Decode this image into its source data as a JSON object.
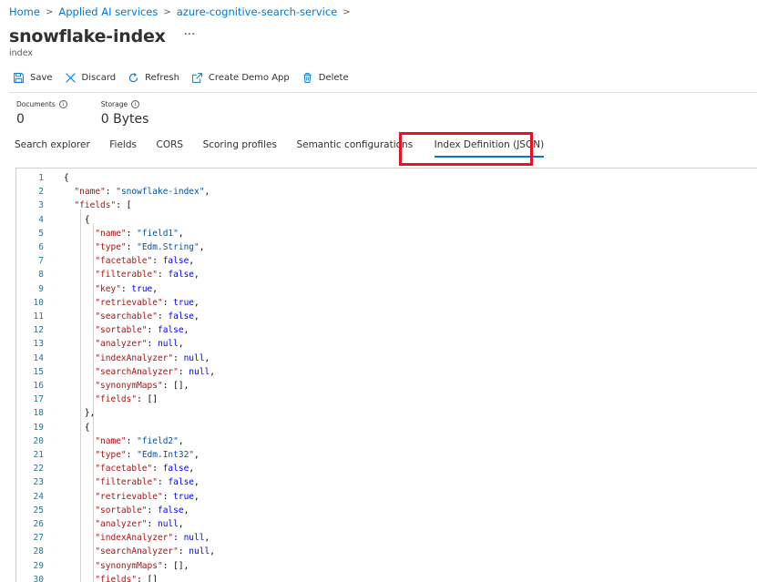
{
  "breadcrumb": {
    "items": [
      "Home",
      "Applied AI services",
      "azure-cognitive-search-service"
    ],
    "separator": ">"
  },
  "page": {
    "title": "snowflake-index",
    "more": "···",
    "subtitle": "index"
  },
  "toolbar": {
    "save": "Save",
    "discard": "Discard",
    "refresh": "Refresh",
    "create_demo_app": "Create Demo App",
    "delete": "Delete"
  },
  "stats": {
    "documents_label": "Documents",
    "documents_value": "0",
    "storage_label": "Storage",
    "storage_value": "0 Bytes"
  },
  "tabs": [
    "Search explorer",
    "Fields",
    "CORS",
    "Scoring profiles",
    "Semantic configurations",
    "Index Definition (JSON)"
  ],
  "active_tab": "Index Definition (JSON)",
  "colors": {
    "accent": "#0078d4",
    "highlight": "#e81123",
    "json_key": "#a31515",
    "json_string": "#0451a5",
    "json_keyword": "#0000ff",
    "line_number": "#237893"
  },
  "editor": {
    "lines": [
      [
        {
          "t": "p",
          "v": "{"
        }
      ],
      [
        {
          "t": "p",
          "v": "  "
        },
        {
          "t": "k",
          "v": "\"name\""
        },
        {
          "t": "p",
          "v": ": "
        },
        {
          "t": "s",
          "v": "\"snowflake-index\""
        },
        {
          "t": "p",
          "v": ","
        }
      ],
      [
        {
          "t": "p",
          "v": "  "
        },
        {
          "t": "k",
          "v": "\"fields\""
        },
        {
          "t": "p",
          "v": ": ["
        }
      ],
      [
        {
          "t": "p",
          "v": "    {"
        }
      ],
      [
        {
          "t": "p",
          "v": "      "
        },
        {
          "t": "k",
          "v": "\"name\""
        },
        {
          "t": "p",
          "v": ": "
        },
        {
          "t": "s",
          "v": "\"field1\""
        },
        {
          "t": "p",
          "v": ","
        }
      ],
      [
        {
          "t": "p",
          "v": "      "
        },
        {
          "t": "k",
          "v": "\"type\""
        },
        {
          "t": "p",
          "v": ": "
        },
        {
          "t": "s",
          "v": "\"Edm.String\""
        },
        {
          "t": "p",
          "v": ","
        }
      ],
      [
        {
          "t": "p",
          "v": "      "
        },
        {
          "t": "k",
          "v": "\"facetable\""
        },
        {
          "t": "p",
          "v": ": "
        },
        {
          "t": "w",
          "v": "false"
        },
        {
          "t": "p",
          "v": ","
        }
      ],
      [
        {
          "t": "p",
          "v": "      "
        },
        {
          "t": "k",
          "v": "\"filterable\""
        },
        {
          "t": "p",
          "v": ": "
        },
        {
          "t": "w",
          "v": "false"
        },
        {
          "t": "p",
          "v": ","
        }
      ],
      [
        {
          "t": "p",
          "v": "      "
        },
        {
          "t": "k",
          "v": "\"key\""
        },
        {
          "t": "p",
          "v": ": "
        },
        {
          "t": "w",
          "v": "true"
        },
        {
          "t": "p",
          "v": ","
        }
      ],
      [
        {
          "t": "p",
          "v": "      "
        },
        {
          "t": "k",
          "v": "\"retrievable\""
        },
        {
          "t": "p",
          "v": ": "
        },
        {
          "t": "w",
          "v": "true"
        },
        {
          "t": "p",
          "v": ","
        }
      ],
      [
        {
          "t": "p",
          "v": "      "
        },
        {
          "t": "k",
          "v": "\"searchable\""
        },
        {
          "t": "p",
          "v": ": "
        },
        {
          "t": "w",
          "v": "false"
        },
        {
          "t": "p",
          "v": ","
        }
      ],
      [
        {
          "t": "p",
          "v": "      "
        },
        {
          "t": "k",
          "v": "\"sortable\""
        },
        {
          "t": "p",
          "v": ": "
        },
        {
          "t": "w",
          "v": "false"
        },
        {
          "t": "p",
          "v": ","
        }
      ],
      [
        {
          "t": "p",
          "v": "      "
        },
        {
          "t": "k",
          "v": "\"analyzer\""
        },
        {
          "t": "p",
          "v": ": "
        },
        {
          "t": "w",
          "v": "null"
        },
        {
          "t": "p",
          "v": ","
        }
      ],
      [
        {
          "t": "p",
          "v": "      "
        },
        {
          "t": "k",
          "v": "\"indexAnalyzer\""
        },
        {
          "t": "p",
          "v": ": "
        },
        {
          "t": "w",
          "v": "null"
        },
        {
          "t": "p",
          "v": ","
        }
      ],
      [
        {
          "t": "p",
          "v": "      "
        },
        {
          "t": "k",
          "v": "\"searchAnalyzer\""
        },
        {
          "t": "p",
          "v": ": "
        },
        {
          "t": "w",
          "v": "null"
        },
        {
          "t": "p",
          "v": ","
        }
      ],
      [
        {
          "t": "p",
          "v": "      "
        },
        {
          "t": "k",
          "v": "\"synonymMaps\""
        },
        {
          "t": "p",
          "v": ": [],"
        }
      ],
      [
        {
          "t": "p",
          "v": "      "
        },
        {
          "t": "k",
          "v": "\"fields\""
        },
        {
          "t": "p",
          "v": ": []"
        }
      ],
      [
        {
          "t": "p",
          "v": "    },"
        }
      ],
      [
        {
          "t": "p",
          "v": "    {"
        }
      ],
      [
        {
          "t": "p",
          "v": "      "
        },
        {
          "t": "k",
          "v": "\"name\""
        },
        {
          "t": "p",
          "v": ": "
        },
        {
          "t": "s",
          "v": "\"field2\""
        },
        {
          "t": "p",
          "v": ","
        }
      ],
      [
        {
          "t": "p",
          "v": "      "
        },
        {
          "t": "k",
          "v": "\"type\""
        },
        {
          "t": "p",
          "v": ": "
        },
        {
          "t": "s",
          "v": "\"Edm.Int32\""
        },
        {
          "t": "p",
          "v": ","
        }
      ],
      [
        {
          "t": "p",
          "v": "      "
        },
        {
          "t": "k",
          "v": "\"facetable\""
        },
        {
          "t": "p",
          "v": ": "
        },
        {
          "t": "w",
          "v": "false"
        },
        {
          "t": "p",
          "v": ","
        }
      ],
      [
        {
          "t": "p",
          "v": "      "
        },
        {
          "t": "k",
          "v": "\"filterable\""
        },
        {
          "t": "p",
          "v": ": "
        },
        {
          "t": "w",
          "v": "false"
        },
        {
          "t": "p",
          "v": ","
        }
      ],
      [
        {
          "t": "p",
          "v": "      "
        },
        {
          "t": "k",
          "v": "\"retrievable\""
        },
        {
          "t": "p",
          "v": ": "
        },
        {
          "t": "w",
          "v": "true"
        },
        {
          "t": "p",
          "v": ","
        }
      ],
      [
        {
          "t": "p",
          "v": "      "
        },
        {
          "t": "k",
          "v": "\"sortable\""
        },
        {
          "t": "p",
          "v": ": "
        },
        {
          "t": "w",
          "v": "false"
        },
        {
          "t": "p",
          "v": ","
        }
      ],
      [
        {
          "t": "p",
          "v": "      "
        },
        {
          "t": "k",
          "v": "\"analyzer\""
        },
        {
          "t": "p",
          "v": ": "
        },
        {
          "t": "w",
          "v": "null"
        },
        {
          "t": "p",
          "v": ","
        }
      ],
      [
        {
          "t": "p",
          "v": "      "
        },
        {
          "t": "k",
          "v": "\"indexAnalyzer\""
        },
        {
          "t": "p",
          "v": ": "
        },
        {
          "t": "w",
          "v": "null"
        },
        {
          "t": "p",
          "v": ","
        }
      ],
      [
        {
          "t": "p",
          "v": "      "
        },
        {
          "t": "k",
          "v": "\"searchAnalyzer\""
        },
        {
          "t": "p",
          "v": ": "
        },
        {
          "t": "w",
          "v": "null"
        },
        {
          "t": "p",
          "v": ","
        }
      ],
      [
        {
          "t": "p",
          "v": "      "
        },
        {
          "t": "k",
          "v": "\"synonymMaps\""
        },
        {
          "t": "p",
          "v": ": [],"
        }
      ],
      [
        {
          "t": "p",
          "v": "      "
        },
        {
          "t": "k",
          "v": "\"fields\""
        },
        {
          "t": "p",
          "v": ": []"
        }
      ]
    ]
  }
}
